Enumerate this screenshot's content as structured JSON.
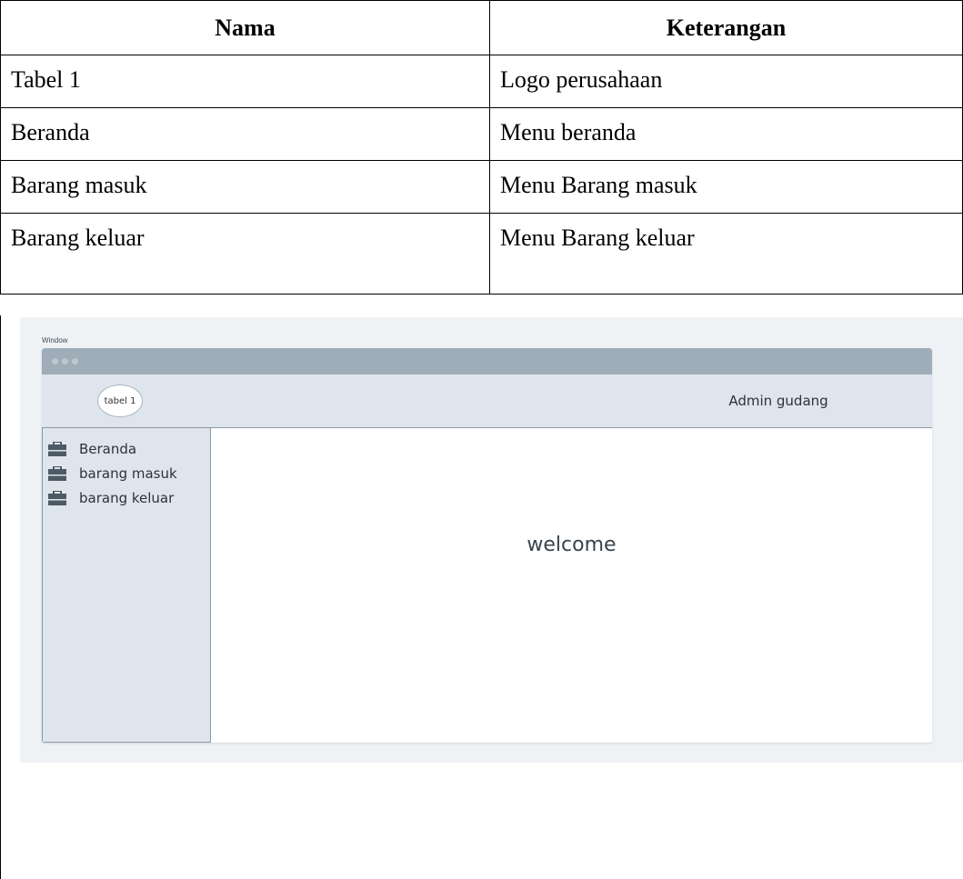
{
  "table": {
    "headers": [
      "Nama",
      "Keterangan"
    ],
    "rows": [
      {
        "nama": "Tabel 1",
        "keterangan": "Logo perusahaan"
      },
      {
        "nama": "Beranda",
        "keterangan": "Menu beranda"
      },
      {
        "nama": "Barang masuk",
        "keterangan": "Menu Barang masuk"
      },
      {
        "nama": "Barang keluar",
        "keterangan": "Menu Barang keluar"
      }
    ]
  },
  "mockup": {
    "window_label": "Window",
    "logo_text": "tabel 1",
    "user_label": "Admin gudang",
    "nav": [
      {
        "label": "Beranda",
        "icon": "briefcase-icon"
      },
      {
        "label": "barang masuk",
        "icon": "briefcase-icon"
      },
      {
        "label": "barang keluar",
        "icon": "briefcase-icon"
      }
    ],
    "content_text": "welcome"
  },
  "colors": {
    "titlebar": "#9fadb9",
    "header_bg": "#dfe5ec",
    "sidebar_bg": "#dfe5ec",
    "canvas_bg": "#eff2f5",
    "icon": "#4d5965"
  }
}
